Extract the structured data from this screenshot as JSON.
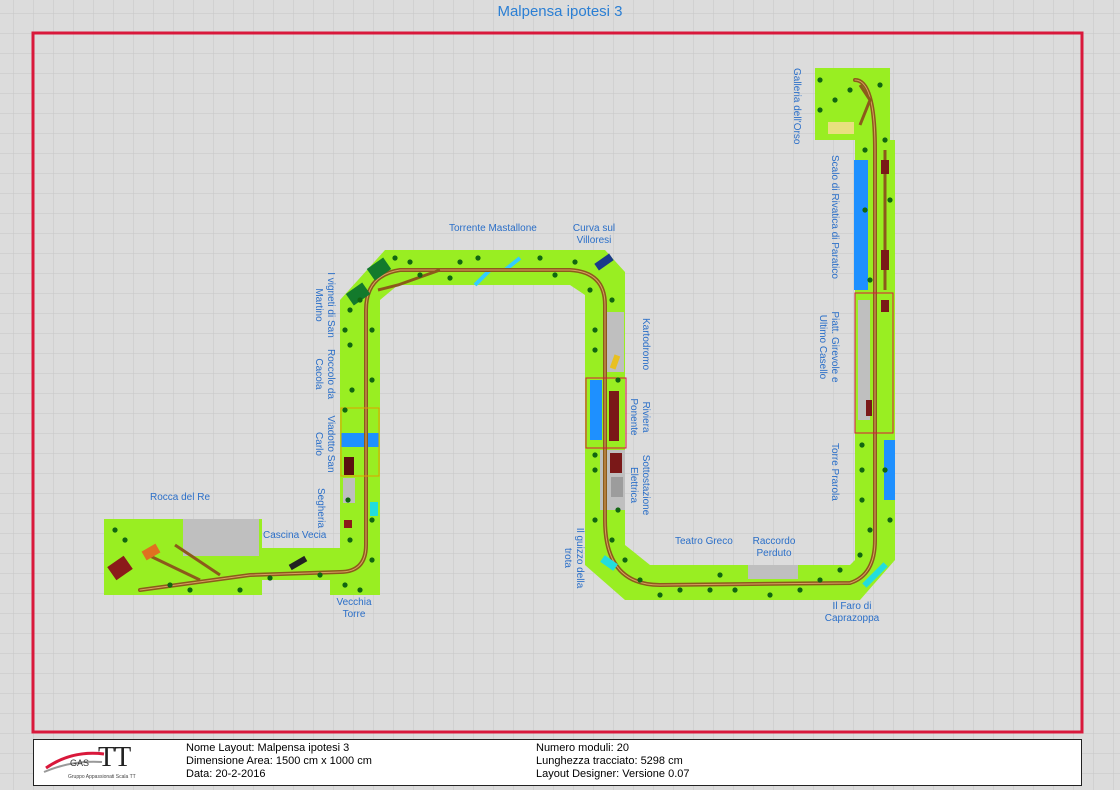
{
  "title": "Malpensa ipotesi 3",
  "colors": {
    "module": "#99ee22",
    "track": "#8b5a1b",
    "frame": "#d9183b",
    "label": "#2b6fc8",
    "tree": "#116611",
    "water": "#1e90ff"
  },
  "stations": [
    {
      "name": "Rocca del Re"
    },
    {
      "name": "Cascina Vecia"
    },
    {
      "name": "Segheria"
    },
    {
      "name": "Vecchia Torre"
    },
    {
      "name": "Viadotto San Carlo"
    },
    {
      "name": "Roccolo da Cacola"
    },
    {
      "name": "I vigneti di San Martino"
    },
    {
      "name": "Torrente Mastallone"
    },
    {
      "name": "Curva sul Villoresi"
    },
    {
      "name": "Kartodromo"
    },
    {
      "name": "Riviera Ponente"
    },
    {
      "name": "Sottostazione Elettrica"
    },
    {
      "name": "Il guizzo della trota"
    },
    {
      "name": "Teatro Greco"
    },
    {
      "name": "Raccordo Perduto"
    },
    {
      "name": "Il Faro di Caprazoppa"
    },
    {
      "name": "Torre Prarola"
    },
    {
      "name": "Piatt. Girevole e Ultimo Casello"
    },
    {
      "name": "Scalo di Rivatica di Paratico"
    },
    {
      "name": "Galleria dell'Orso"
    }
  ],
  "info": {
    "logo_main": "TT",
    "logo_gas": "GAS",
    "logo_sub": "Gruppo Appassionati Scala TT",
    "layout_name": "Nome Layout: Malpensa ipotesi 3",
    "area": "Dimensione Area: 1500 cm x 1000 cm",
    "date": "Data: 20-2-2016",
    "modules": "Numero moduli: 20",
    "track_length": "Lunghezza tracciato: 5298 cm",
    "designer": "Layout Designer: Versione 0.07"
  }
}
